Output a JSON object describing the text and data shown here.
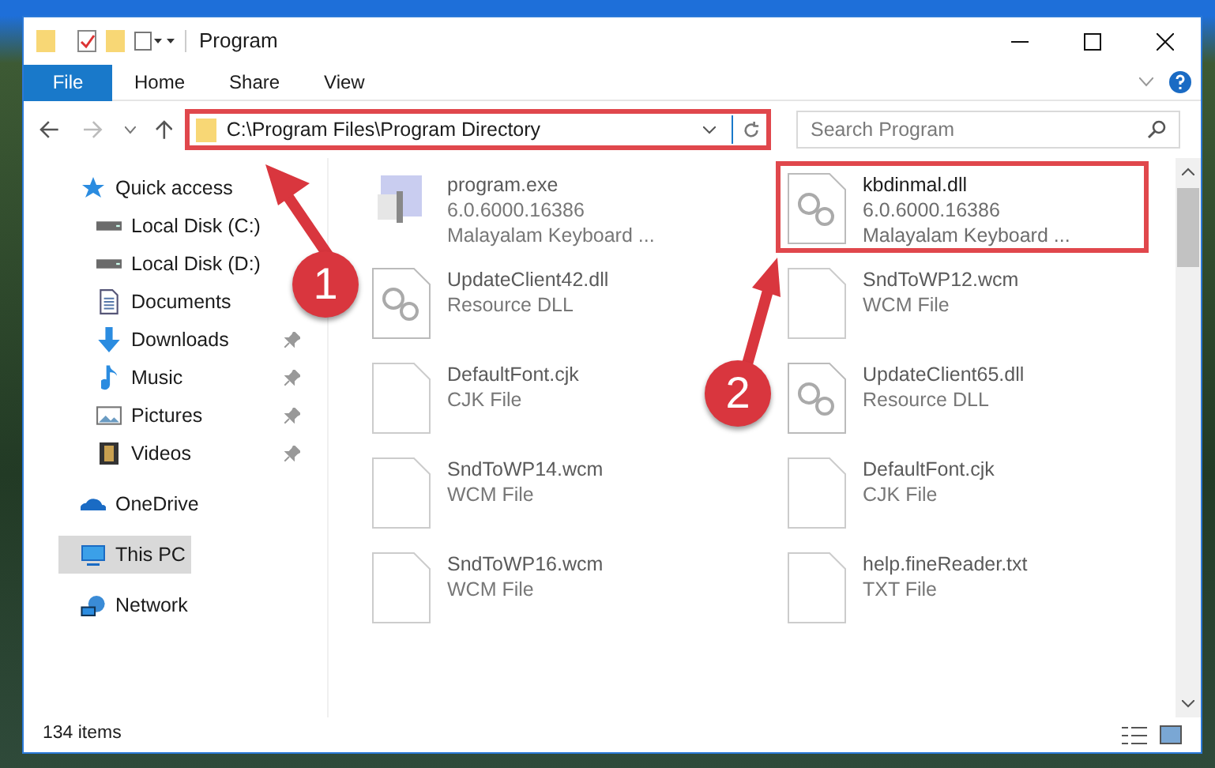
{
  "window": {
    "title": "Program"
  },
  "ribbon_tabs": [
    {
      "label": "File",
      "selected": true
    },
    {
      "label": "Home",
      "selected": false
    },
    {
      "label": "Share",
      "selected": false
    },
    {
      "label": "View",
      "selected": false
    }
  ],
  "address": {
    "path": "C:\\Program Files\\Program Directory",
    "highlighted": true
  },
  "search": {
    "placeholder": "Search Program"
  },
  "sidebar": {
    "items": [
      {
        "label": "Quick access",
        "pinned": false,
        "selected": false,
        "children": [
          {
            "label": "Local Disk (C:)",
            "pinned": false,
            "selected": false
          },
          {
            "label": "Local Disk (D:)",
            "pinned": false,
            "selected": false
          },
          {
            "label": "Documents",
            "pinned": false,
            "selected": false
          },
          {
            "label": "Downloads",
            "pinned": true,
            "selected": false
          },
          {
            "label": "Music",
            "pinned": true,
            "selected": false
          },
          {
            "label": "Pictures",
            "pinned": true,
            "selected": false
          },
          {
            "label": "Videos",
            "pinned": true,
            "selected": false
          }
        ]
      },
      {
        "label": "OneDrive",
        "pinned": false,
        "selected": false
      },
      {
        "label": "This PC",
        "pinned": false,
        "selected": true
      },
      {
        "label": "Network",
        "pinned": false,
        "selected": false
      }
    ]
  },
  "files": [
    {
      "name": "program.exe",
      "lines": [
        "6.0.6000.16386",
        "Malayalam Keyboard ..."
      ],
      "kind": "program",
      "highlighted": false
    },
    {
      "name": "kbdinmal.dll",
      "lines": [
        "6.0.6000.16386",
        "Malayalam Keyboard ..."
      ],
      "kind": "gear",
      "highlighted": true
    },
    {
      "name": "UpdateClient42.dll",
      "lines": [
        "Resource DLL"
      ],
      "kind": "gear",
      "highlighted": false
    },
    {
      "name": "SndToWP12.wcm",
      "lines": [
        "WCM File"
      ],
      "kind": "blank",
      "highlighted": false
    },
    {
      "name": "DefaultFont.cjk",
      "lines": [
        "CJK File"
      ],
      "kind": "blank",
      "highlighted": false
    },
    {
      "name": "UpdateClient65.dll",
      "lines": [
        "Resource DLL"
      ],
      "kind": "gear",
      "highlighted": false
    },
    {
      "name": "SndToWP14.wcm",
      "lines": [
        "WCM File"
      ],
      "kind": "blank",
      "highlighted": false
    },
    {
      "name": "DefaultFont.cjk",
      "lines": [
        "CJK File"
      ],
      "kind": "blank",
      "highlighted": false
    },
    {
      "name": "SndToWP16.wcm",
      "lines": [
        "WCM File"
      ],
      "kind": "blank",
      "highlighted": false
    },
    {
      "name": "help.fineReader.txt",
      "lines": [
        "TXT File"
      ],
      "kind": "blank",
      "highlighted": false
    }
  ],
  "callouts": [
    {
      "number": "1"
    },
    {
      "number": "2"
    }
  ],
  "status_bar": {
    "count": "134 items"
  }
}
